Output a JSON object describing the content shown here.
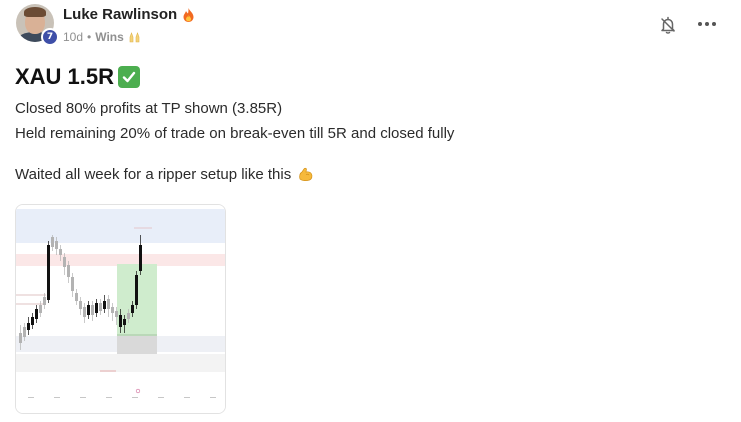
{
  "author": {
    "name": "Luke Rawlinson",
    "level": "7",
    "time": "10d",
    "separator": "•",
    "category": "Wins",
    "category_icon": "raising-hands-icon",
    "name_icon": "fire-icon"
  },
  "actions": {
    "notify_icon": "bell-off-icon",
    "more_icon": "more-horizontal-icon"
  },
  "post": {
    "title": "XAU 1.5R",
    "title_icon": "check-mark-icon",
    "line1": "Closed 80% profits at TP shown (3.85R)",
    "line2": "Held remaining 20% of trade on break-even till 5R and closed fully",
    "line3": "Waited all week for a ripper setup like this",
    "line3_icon": "flexed-biceps-icon"
  },
  "attachment": {
    "type": "trading-chart-thumbnail",
    "colors": {
      "take_profit_zone": "#cfeccd",
      "stop_loss_zone": "#d9d9d9",
      "upper_band": "#e8eef9",
      "resistance_band": "#fbe7e7",
      "lower_band": "#eef0f5"
    }
  },
  "colors": {
    "level_badge": "#3e4fa8",
    "check": "#4cae4f",
    "fire": "#f26a21"
  }
}
